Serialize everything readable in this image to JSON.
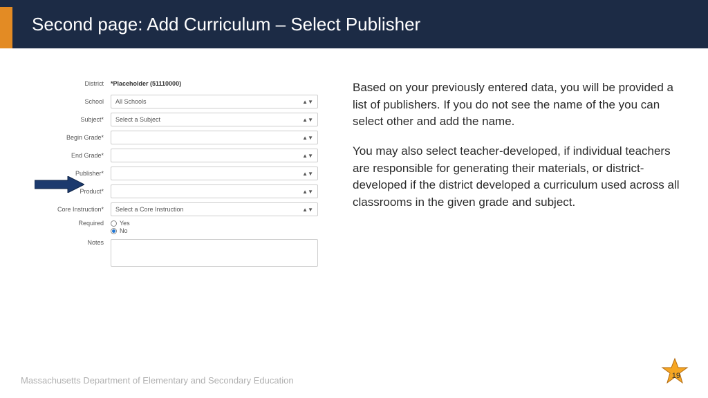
{
  "header": {
    "title": "Second page: Add Curriculum – Select Publisher"
  },
  "form": {
    "district_label": "District",
    "district_value": "*Placeholder (51110000)",
    "school_label": "School",
    "school_value": "All Schools",
    "subject_label": "Subject*",
    "subject_value": "Select a Subject",
    "begin_grade_label": "Begin Grade*",
    "begin_grade_value": "",
    "end_grade_label": "End Grade*",
    "end_grade_value": "",
    "publisher_label": "Publisher*",
    "publisher_value": "",
    "product_label": "Product*",
    "product_value": "",
    "core_label": "Core Instruction*",
    "core_value": "Select a Core Instruction",
    "required_label": "Required",
    "required_yes": "Yes",
    "required_no": "No",
    "notes_label": "Notes"
  },
  "description": {
    "p1": "Based on your previously entered data, you will be provided a list of publishers. If you do not see the name of the you can select other and add the name.",
    "p2": "You may also select teacher-developed, if individual teachers are responsible for generating their materials, or district-developed if the district developed a curriculum used across all classrooms in the given grade and subject."
  },
  "footer": "Massachusetts Department of Elementary and Secondary Education",
  "page_number": "19"
}
